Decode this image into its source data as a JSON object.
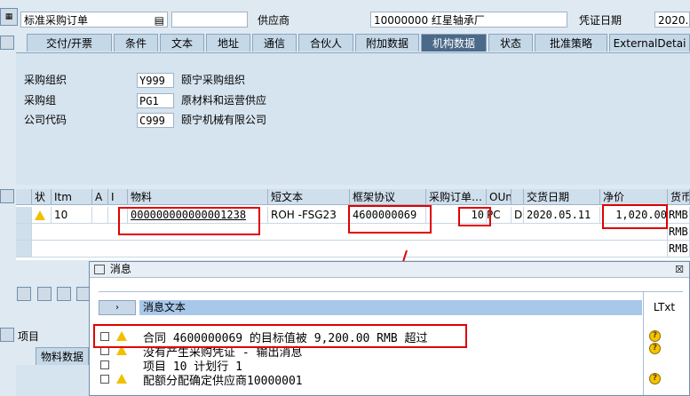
{
  "header": {
    "doc_type": "标准采购订单",
    "vendor_label": "供应商",
    "vendor_value": "10000000 红星轴承厂",
    "doc_date_label": "凭证日期",
    "doc_date_value": "2020."
  },
  "tabs": [
    "交付/开票",
    "条件",
    "文本",
    "地址",
    "通信",
    "合伙人",
    "附加数据",
    "机构数据",
    "状态",
    "批准策略",
    "ExternalDetai"
  ],
  "active_tab": "机构数据",
  "org": {
    "purch_org_label": "采购组织",
    "purch_org_code": "Y999",
    "purch_org_name": "颐宁采购组织",
    "purch_group_label": "采购组",
    "purch_group_code": "PG1",
    "purch_group_name": "原材料和运营供应",
    "company_label": "公司代码",
    "company_code": "C999",
    "company_name": "颐宁机械有限公司"
  },
  "table": {
    "headers": [
      "状",
      "Itm",
      "A",
      "I",
      "物料",
      "短文本",
      "框架协议",
      "采购订单…",
      "OUn",
      "",
      "交货日期",
      "净价",
      "货币"
    ],
    "row": {
      "itm": "10",
      "material": "000000000000001238",
      "short_text": "ROH -FSG23",
      "contract": "4600000069",
      "qty": "10",
      "oun": "PC",
      "d": "D",
      "delivery": "2020.05.11",
      "net_price": "1,020.00",
      "currency": "RMB"
    },
    "extra_currency": [
      "RMB",
      "RMB"
    ]
  },
  "left_section": {
    "items_label": "项目",
    "material_data_tab": "物料数据"
  },
  "dialog": {
    "title": "消息",
    "column_header": "消息文本",
    "ltxt_header": "LTxt",
    "messages": [
      "合同 4600000069 的目标值被 9,200.00 RMB 超过",
      "没有产生采购凭证 - 输出消息",
      "项目 10 计划行 1",
      "配额分配确定供应商10000001"
    ]
  }
}
